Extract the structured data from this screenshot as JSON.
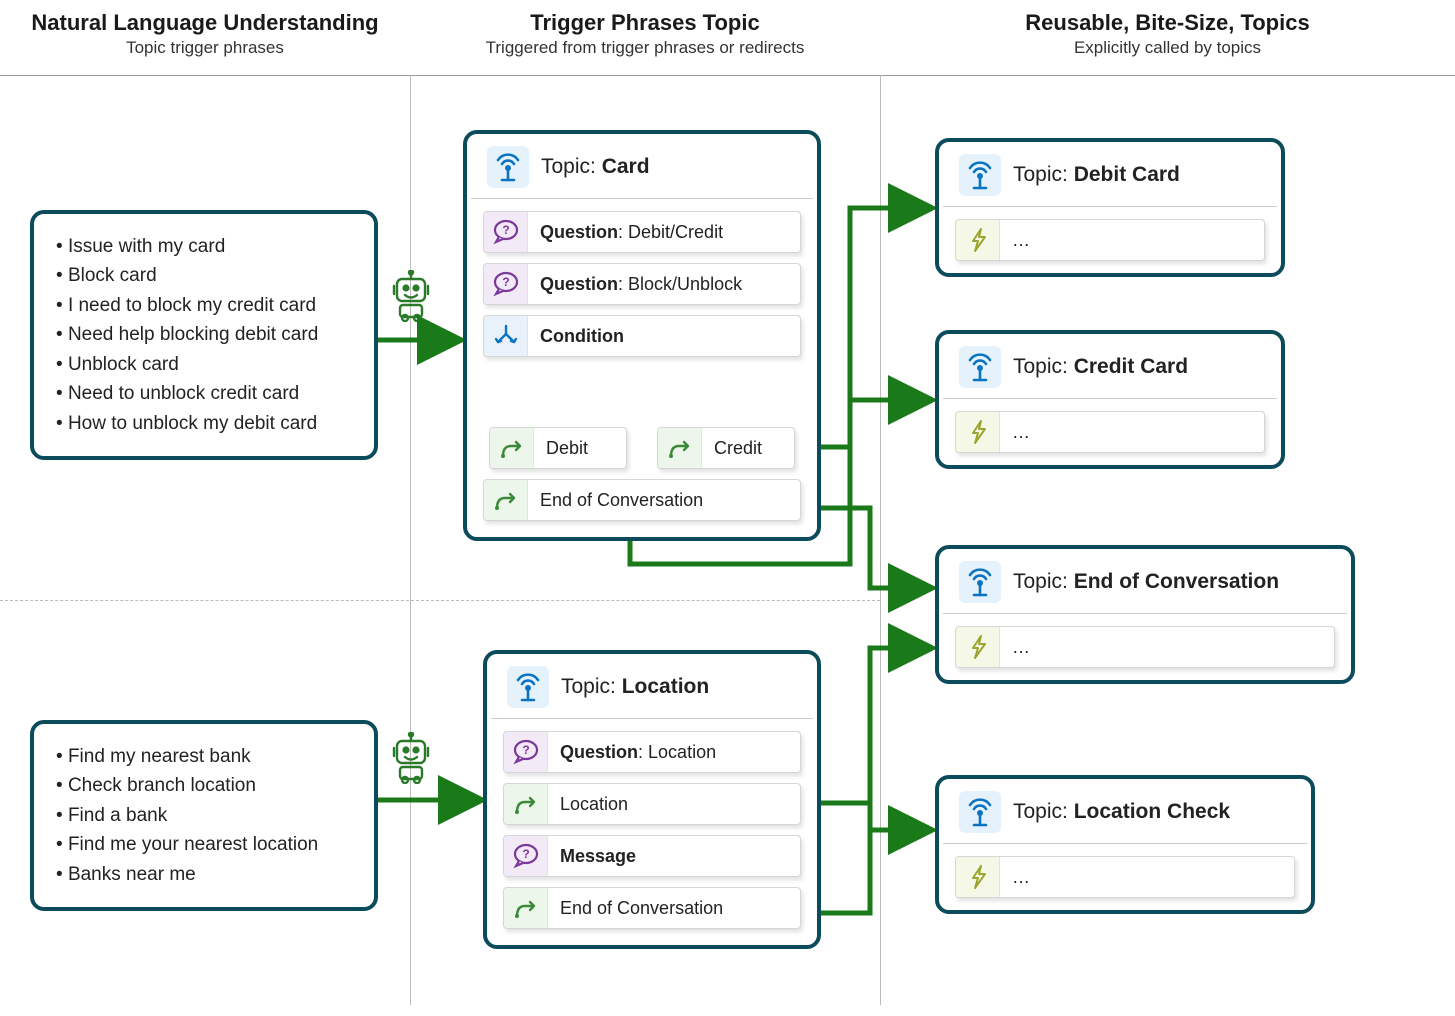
{
  "columns": {
    "nlu": {
      "title": "Natural Language Understanding",
      "subtitle": "Topic trigger phrases"
    },
    "trigger": {
      "title": "Trigger Phrases Topic",
      "subtitle": "Triggered from trigger phrases or redirects"
    },
    "reusable": {
      "title": "Reusable, Bite-Size, Topics",
      "subtitle": "Explicitly called by topics"
    }
  },
  "nlu_card": [
    "Issue with my card",
    "Block card",
    "I need to block my credit card",
    "Need help blocking debit card",
    "Unblock card",
    "Need to unblock credit card",
    "How to unblock my debit card"
  ],
  "nlu_location": [
    "Find my nearest bank",
    "Check branch location",
    "Find a bank",
    "Find me your nearest location",
    "Banks near me"
  ],
  "topic_card": {
    "title_prefix": "Topic",
    "title_name": "Card",
    "q1_prefix": "Question",
    "q1_value": "Debit/Credit",
    "q2_prefix": "Question",
    "q2_value": "Block/Unblock",
    "condition": "Condition",
    "branch_debit": "Debit",
    "branch_credit": "Credit",
    "end": "End of Conversation"
  },
  "topic_location": {
    "title_prefix": "Topic",
    "title_name": "Location",
    "q1_prefix": "Question",
    "q1_value": "Location",
    "redirect1": "Location",
    "message": "Message",
    "end": "End of Conversation"
  },
  "mini": {
    "debit": {
      "prefix": "Topic",
      "name": "Debit Card",
      "dots": "…"
    },
    "credit": {
      "prefix": "Topic",
      "name": "Credit Card",
      "dots": "…"
    },
    "eoc": {
      "prefix": "Topic",
      "name": "End of Conversation",
      "dots": "…"
    },
    "loc": {
      "prefix": "Topic",
      "name": "Location Check",
      "dots": "…"
    }
  }
}
